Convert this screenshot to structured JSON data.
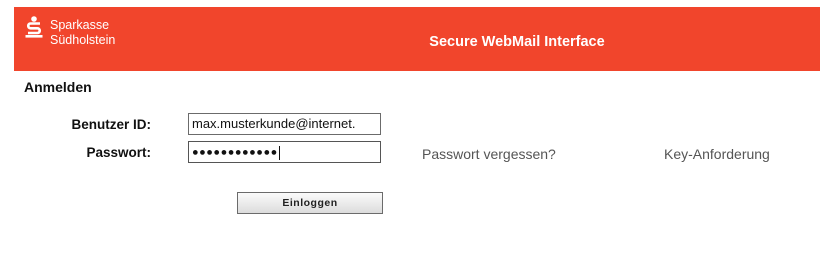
{
  "header": {
    "brand_line1": "Sparkasse",
    "brand_line2": "Südholstein",
    "title": "Secure WebMail Interface",
    "background_color": "#f1452c",
    "logo_icon": "sparkasse-s-icon"
  },
  "login": {
    "section_title": "Anmelden",
    "user_label": "Benutzer ID:",
    "user_value": "max.musterkunde@internet.",
    "password_label": "Passwort:",
    "password_masked": "●●●●●●●●●●●●",
    "forgot_password": "Passwort vergessen?",
    "key_request": "Key-Anforderung",
    "submit_label": "Einloggen"
  }
}
